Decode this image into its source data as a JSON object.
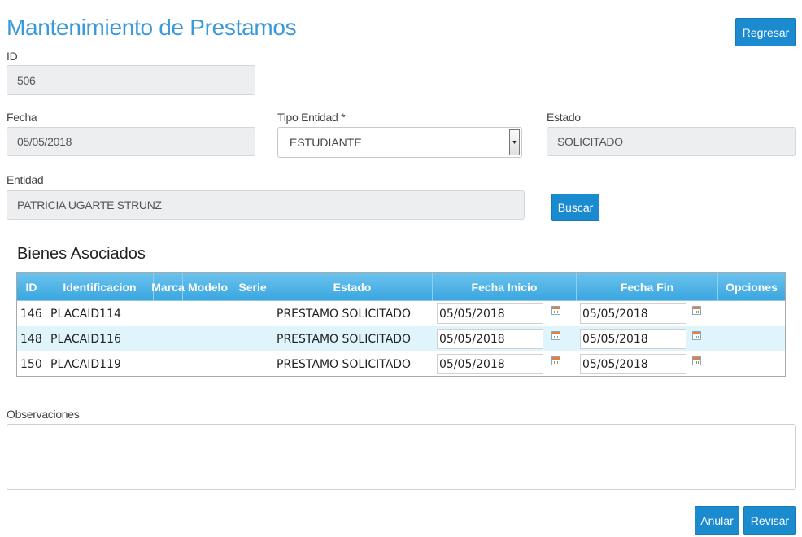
{
  "page": {
    "title": "Mantenimiento de Prestamos"
  },
  "header": {
    "back_label": "Regresar"
  },
  "form": {
    "id_label": "ID",
    "id_value": "506",
    "fecha_label": "Fecha",
    "fecha_value": "05/05/2018",
    "tipo_label": "Tipo Entidad *",
    "tipo_value": "ESTUDIANTE",
    "estado_label": "Estado",
    "estado_value": "SOLICITADO",
    "entidad_label": "Entidad",
    "entidad_value": "PATRICIA  UGARTE STRUNZ",
    "buscar_label": "Buscar"
  },
  "bienes": {
    "title": "Bienes Asociados",
    "columns": [
      "ID",
      "Identificacion",
      "Marca",
      "Modelo",
      "Serie",
      "Estado",
      "Fecha Inicio",
      "Fecha Fin",
      "Opciones"
    ],
    "rows": [
      {
        "id": "146",
        "identificacion": "PLACAID114",
        "marca": "",
        "modelo": "",
        "serie": "",
        "estado": "PRESTAMO SOLICITADO",
        "fecha_inicio": "05/05/2018",
        "fecha_fin": "05/05/2018",
        "opciones": ""
      },
      {
        "id": "148",
        "identificacion": "PLACAID116",
        "marca": "",
        "modelo": "",
        "serie": "",
        "estado": "PRESTAMO SOLICITADO",
        "fecha_inicio": "05/05/2018",
        "fecha_fin": "05/05/2018",
        "opciones": ""
      },
      {
        "id": "150",
        "identificacion": "PLACAID119",
        "marca": "",
        "modelo": "",
        "serie": "",
        "estado": "PRESTAMO SOLICITADO",
        "fecha_inicio": "05/05/2018",
        "fecha_fin": "05/05/2018",
        "opciones": ""
      }
    ]
  },
  "observaciones": {
    "label": "Observaciones",
    "value": ""
  },
  "footer": {
    "anular_label": "Anular",
    "revisar_label": "Revisar"
  },
  "colors": {
    "accent": "#1b8bd0",
    "title": "#3a9ad9",
    "header_grid": "#3aa6e0",
    "row_alt": "#dff4fb"
  },
  "icons": {
    "calendar": "calendar-icon",
    "select_arrow": "chevron-down-icon"
  }
}
